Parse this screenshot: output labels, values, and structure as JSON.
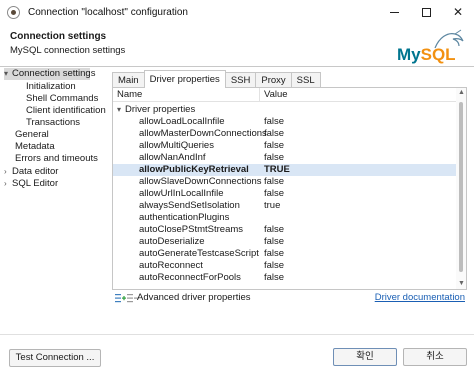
{
  "window": {
    "title": "Connection \"localhost\" configuration",
    "minimize_symbol": "—",
    "maximize_symbol": "☐",
    "close_symbol": "✕"
  },
  "header": {
    "title": "Connection settings",
    "subtitle": "MySQL connection settings",
    "logo_text": "MySQL"
  },
  "tree": {
    "items": [
      {
        "label": "Connection settings",
        "expanded": true,
        "selected": true
      },
      {
        "label": "Initialization"
      },
      {
        "label": "Shell Commands"
      },
      {
        "label": "Client identification"
      },
      {
        "label": "Transactions"
      },
      {
        "label": "General"
      },
      {
        "label": "Metadata"
      },
      {
        "label": "Errors and timeouts"
      },
      {
        "label": "Data editor",
        "expandable": true
      },
      {
        "label": "SQL Editor",
        "expandable": true
      }
    ]
  },
  "tabs": [
    {
      "label": "Main"
    },
    {
      "label": "Driver properties",
      "active": true
    },
    {
      "label": "SSH"
    },
    {
      "label": "Proxy"
    },
    {
      "label": "SSL"
    }
  ],
  "table": {
    "col_name": "Name",
    "col_value": "Value",
    "group_label": "Driver properties",
    "rows": [
      {
        "name": "allowLoadLocalInfile",
        "value": "false"
      },
      {
        "name": "allowMasterDownConnections",
        "value": "false"
      },
      {
        "name": "allowMultiQueries",
        "value": "false"
      },
      {
        "name": "allowNanAndInf",
        "value": "false"
      },
      {
        "name": "allowPublicKeyRetrieval",
        "value": "TRUE",
        "selected": true
      },
      {
        "name": "allowSlaveDownConnections",
        "value": "false"
      },
      {
        "name": "allowUrlInLocalInfile",
        "value": "false"
      },
      {
        "name": "alwaysSendSetIsolation",
        "value": "true"
      },
      {
        "name": "authenticationPlugins",
        "value": ""
      },
      {
        "name": "autoClosePStmtStreams",
        "value": "false"
      },
      {
        "name": "autoDeserialize",
        "value": "false"
      },
      {
        "name": "autoGenerateTestcaseScript",
        "value": "false"
      },
      {
        "name": "autoReconnect",
        "value": "false"
      },
      {
        "name": "autoReconnectForPools",
        "value": "false"
      }
    ]
  },
  "panel_tools": {
    "advanced_label": "Advanced driver properties",
    "doc_link": "Driver documentation"
  },
  "footer": {
    "test_button": "Test Connection ...",
    "ok_button": "확인",
    "cancel_button": "취소"
  }
}
